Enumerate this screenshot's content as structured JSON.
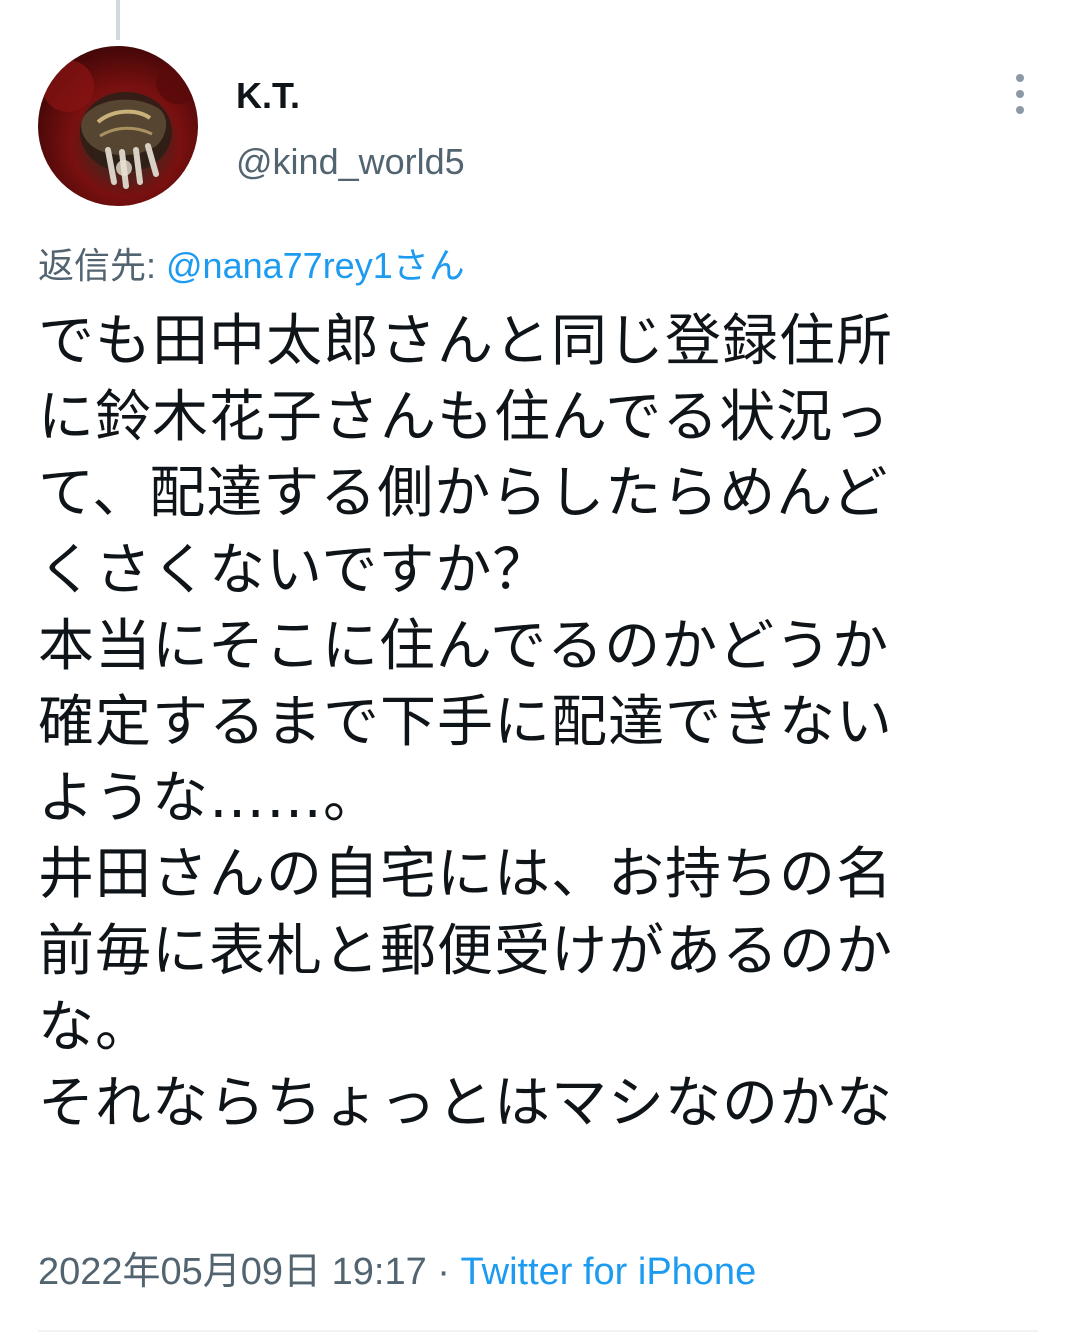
{
  "tweet": {
    "author": {
      "display_name": "K.T.",
      "handle": "@kind_world5",
      "avatar_icon": "avatar-icon"
    },
    "more_icon": "more-icon",
    "reply": {
      "prefix": "返信先: ",
      "mention": "@nana77rey1さん"
    },
    "lines": [
      "でも田中太郎さんと同じ登録住所",
      "に鈴木花子さんも住んでる状況っ",
      "て、配達する側からしたらめんど",
      "くさくないですか？",
      "本当にそこに住んでるのかどうか",
      "確定するまで下手に配達できない",
      "ような……。",
      "井田さんの自宅には、お持ちの名",
      "前毎に表札と郵便受けがあるのか",
      "な。",
      "それならちょっとはマシなのかな"
    ],
    "timestamp": "2022年05月09日 19:17",
    "separator": " · ",
    "source": "Twitter for iPhone"
  },
  "colors": {
    "text_primary": "#0f1419",
    "text_secondary": "#536471",
    "link": "#1d9bf0",
    "divider": "#eff3f4"
  }
}
